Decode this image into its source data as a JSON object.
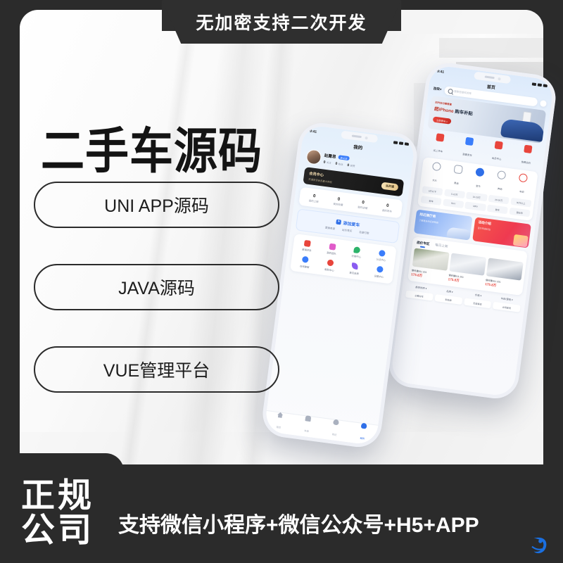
{
  "poster": {
    "top_ribbon": "无加密支持二次开发",
    "headline": "二手车源码",
    "pills": [
      "UNI APP源码",
      "JAVA源码",
      "VUE管理平台"
    ],
    "bottom_badge_line1": "正规",
    "bottom_badge_line2": "公司",
    "bottom_message": "支持微信小程序+微信公众号+H5+APP",
    "watermark": "watermark-logo",
    "colors": {
      "dark": "#2b2b2b",
      "accent_blue": "#2f6fe8",
      "accent_red": "#e8453c",
      "gold": "#f2dcb0"
    }
  },
  "front_phone": {
    "status_time": "9:41",
    "page_title": "我的",
    "user": {
      "name": "赵露思",
      "badge": "未认证",
      "stats": [
        {
          "value": "0",
          "label": "关注"
        },
        {
          "value": "0",
          "label": "粉丝"
        },
        {
          "value": "0",
          "label": "获赞"
        }
      ]
    },
    "vip": {
      "title": "会员中心",
      "subtitle": "开通享受会员最大特权",
      "button": "去开通"
    },
    "stats": [
      {
        "value": "0",
        "label": "我的上架"
      },
      {
        "value": "0",
        "label": "我的收藏"
      },
      {
        "value": "0",
        "label": "我的店铺"
      },
      {
        "value": "0",
        "label": "我的发布"
      }
    ],
    "add_car": {
      "title": "添加爱车",
      "sub": [
        "置换卖家",
        "出价竞买",
        "急速打款"
      ]
    },
    "grid": [
      {
        "label": "邀请好友",
        "icon": "invite-icon",
        "color": "#e8453c"
      },
      {
        "label": "我的团队",
        "icon": "team-icon",
        "color": "#e05bc9"
      },
      {
        "label": "分销中心",
        "icon": "distribution-icon",
        "color": "#2db36a"
      },
      {
        "label": "认证中心",
        "icon": "verify-icon",
        "color": "#3a7dfb"
      },
      {
        "label": "在线客服",
        "icon": "service-icon",
        "color": "#3a7dfb"
      },
      {
        "label": "帮助中心",
        "icon": "help-icon",
        "color": "#e8453c"
      },
      {
        "label": "意见反馈",
        "icon": "feedback-icon",
        "color": "#8a5cf0"
      },
      {
        "label": "设置中心",
        "icon": "settings-icon",
        "color": "#3a7dfb"
      }
    ],
    "tabs": [
      {
        "label": "首页",
        "icon": "home-icon",
        "active": false
      },
      {
        "label": "车源",
        "icon": "car-icon",
        "active": false
      },
      {
        "label": "附近",
        "icon": "location-icon",
        "active": false
      },
      {
        "label": "我的",
        "icon": "person-icon",
        "active": true
      }
    ]
  },
  "back_phone": {
    "status_time": "9:41",
    "page_title": "首页",
    "location": "西安",
    "search_placeholder": "搜索您想买的车",
    "banner": {
      "small": "旧汽车分期首套",
      "title_a": "超iPhone",
      "title_b": "购车补贴",
      "cta": "立即参与 >"
    },
    "categories": [
      {
        "label": "买二手车",
        "icon": "buy-car-icon",
        "color": "#e8453c"
      },
      {
        "label": "我要卖车",
        "icon": "sell-car-icon",
        "color": "#3a7dfb"
      },
      {
        "label": "会员中心",
        "icon": "member-icon",
        "color": "#e8453c"
      },
      {
        "label": "免费估价",
        "icon": "appraisal-icon",
        "color": "#e8453c"
      }
    ],
    "brands": [
      "大众",
      "奥迪",
      "宝马",
      "奔驰",
      "丰田"
    ],
    "price_chips": [
      "5万以下",
      "5-10万",
      "10-20万",
      "20-30万",
      "30万以上"
    ],
    "body_chips": [
      "轿车",
      "SUV",
      "MPV",
      "跑车",
      "面包车"
    ],
    "promos": [
      {
        "title": "附近展厅商",
        "sub": "了解更多附近经销商",
        "style": "blue"
      },
      {
        "title": "活动介绍",
        "sub": "百万车发红包",
        "style": "red"
      }
    ],
    "deals": {
      "tabs": [
        {
          "label": "底价专区",
          "active": true
        },
        {
          "label": "每日上新",
          "active": false
        }
      ],
      "cars": [
        {
          "name": "保时捷911 201",
          "price": "175.8万"
        },
        {
          "name": "保时捷911 201",
          "price": "175.8万"
        },
        {
          "name": "保时捷911 201",
          "price": "175.8万"
        }
      ]
    },
    "filters": [
      "推荐排序",
      "品牌",
      "价格",
      "车龄/里程"
    ],
    "filter_tags": [
      "必看好车",
      "新能源",
      "无烟事故",
      "全网最低"
    ]
  }
}
